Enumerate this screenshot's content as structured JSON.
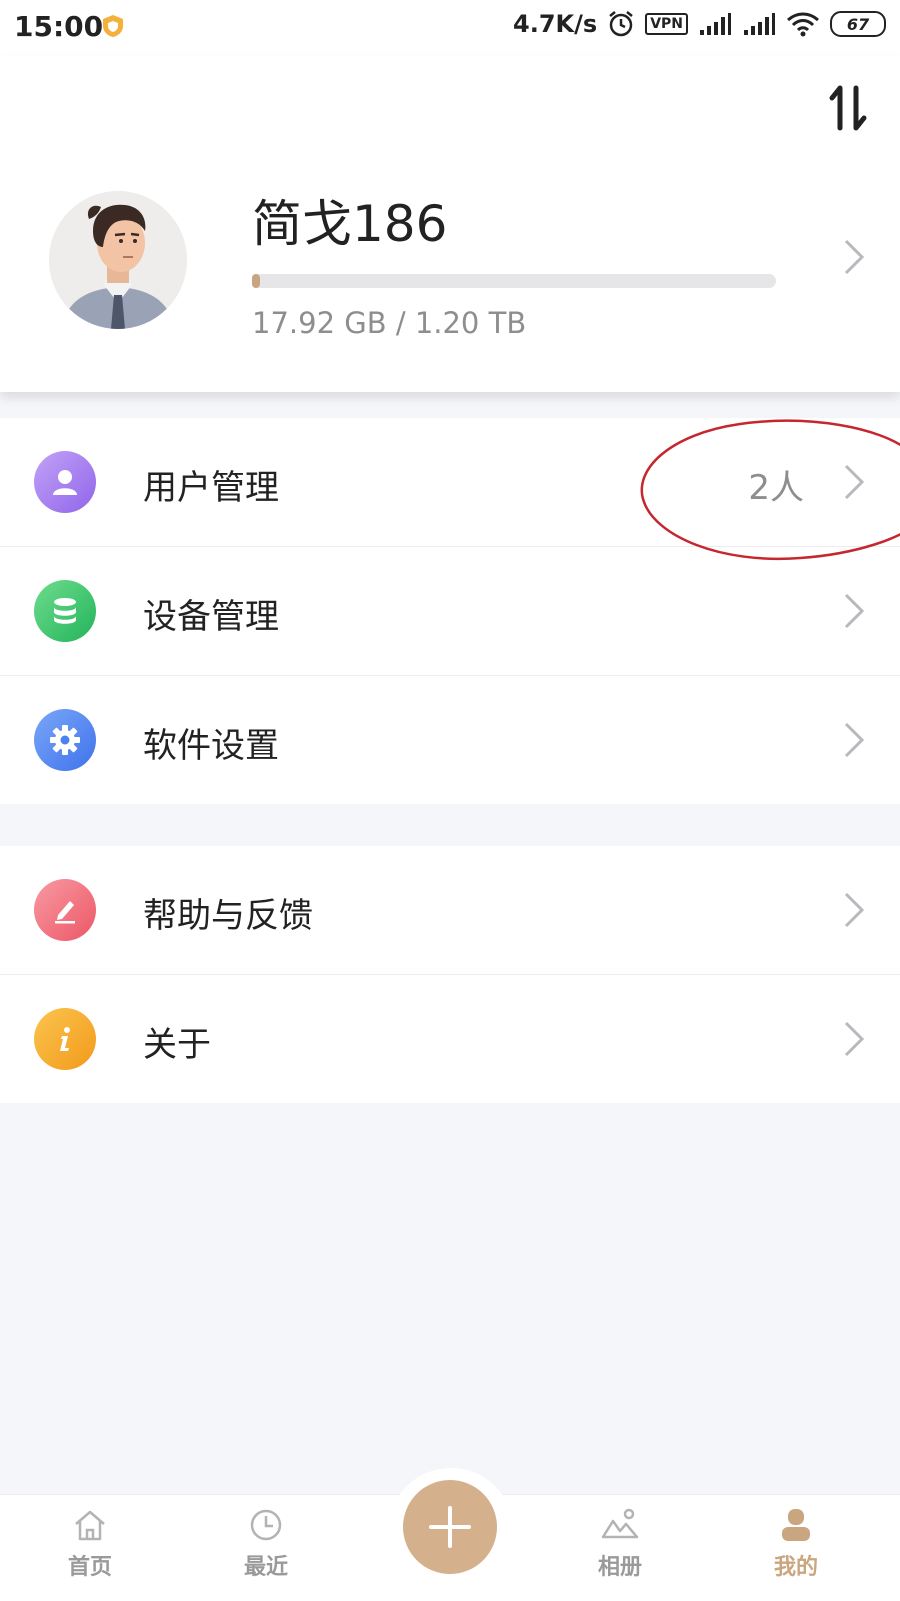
{
  "status_bar": {
    "time": "15:00",
    "speed": "4.7K/s",
    "vpn": "VPN",
    "battery": "67",
    "icons": [
      "shield-icon",
      "alarm-icon",
      "signal-icon",
      "signal-icon",
      "wifi-icon",
      "battery-icon"
    ]
  },
  "profile": {
    "name": "简戈186",
    "storage_text": "17.92 GB / 1.20 TB",
    "storage_used_fraction": 0.015,
    "accent": "#c8a47f"
  },
  "menu": {
    "group1": [
      {
        "label": "用户管理",
        "value": "2人",
        "icon": "user-icon",
        "color": "#a57bf0"
      },
      {
        "label": "设备管理",
        "value": "",
        "icon": "database-icon",
        "color": "#37c26a"
      },
      {
        "label": "软件设置",
        "value": "",
        "icon": "gear-icon",
        "color": "#4b82f0"
      }
    ],
    "group2": [
      {
        "label": "帮助与反馈",
        "value": "",
        "icon": "edit-icon",
        "color": "#f06a78"
      },
      {
        "label": "关于",
        "value": "",
        "icon": "info-icon",
        "color": "#f5a623"
      }
    ]
  },
  "bottom_nav": {
    "items": [
      {
        "label": "首页",
        "icon": "home-icon"
      },
      {
        "label": "最近",
        "icon": "clock-icon"
      },
      {
        "label": "相册",
        "icon": "album-icon"
      },
      {
        "label": "我的",
        "icon": "profile-icon",
        "active": true
      }
    ],
    "fab_icon": "plus-icon",
    "active_color": "#c9a67f"
  }
}
